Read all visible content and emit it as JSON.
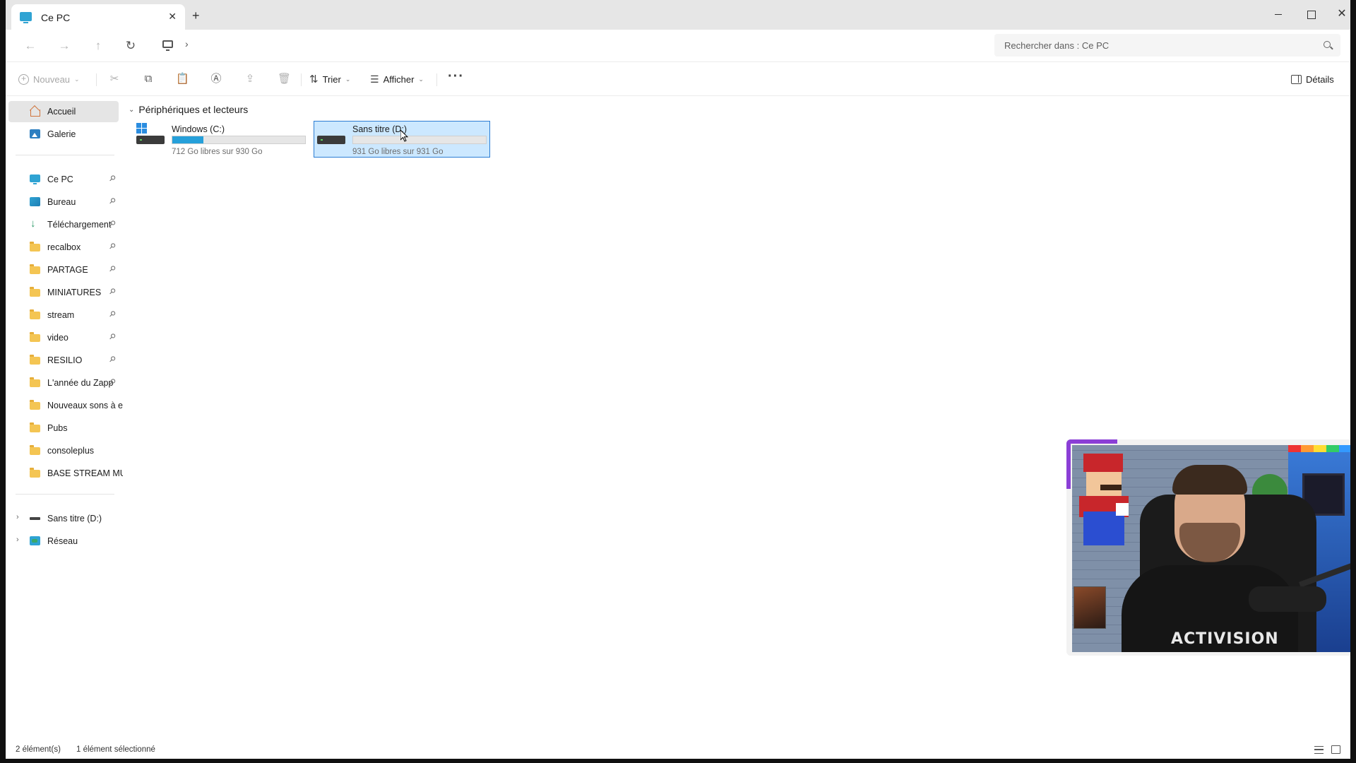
{
  "tab": {
    "title": "Ce PC",
    "close": "✕",
    "new": "+"
  },
  "window_controls": {
    "close": "✕"
  },
  "address": {
    "back": "←",
    "forward": "→",
    "up": "↑",
    "refresh": "↻",
    "chevron": "›",
    "search_placeholder": "Rechercher dans : Ce PC"
  },
  "commandbar": {
    "new_label": "Nouveau",
    "sort_label": "Trier",
    "view_label": "Afficher",
    "more": "···",
    "details_label": "Détails",
    "dropdown": "⌄",
    "icons": {
      "cut": "✂",
      "copy": "⧉",
      "paste": "📋",
      "rename": "Ⓐ",
      "share": "⇪",
      "delete": "🗑",
      "sort": "⇅",
      "view": "☰"
    }
  },
  "sidebar": {
    "top_items": [
      {
        "label": "Accueil",
        "icon": "home-icon",
        "selected": true
      },
      {
        "label": "Galerie",
        "icon": "gallery-icon"
      }
    ],
    "pinned_items": [
      {
        "label": "Ce PC",
        "icon": "pc-icon",
        "pinned": true
      },
      {
        "label": "Bureau",
        "icon": "desktop-icon",
        "pinned": true
      },
      {
        "label": "Téléchargement",
        "icon": "download-icon",
        "pinned": true
      },
      {
        "label": "recalbox",
        "icon": "folder-icon",
        "pinned": true
      },
      {
        "label": "PARTAGE",
        "icon": "folder-icon",
        "pinned": true
      },
      {
        "label": "MINIATURES",
        "icon": "folder-icon",
        "pinned": true
      },
      {
        "label": "stream",
        "icon": "folder-icon",
        "pinned": true
      },
      {
        "label": "video",
        "icon": "folder-icon",
        "pinned": true
      },
      {
        "label": "RESILIO",
        "icon": "folder-icon",
        "pinned": true
      },
      {
        "label": "L'année du Zapp",
        "icon": "folder-icon",
        "pinned": true
      },
      {
        "label": "Nouveaux sons à er",
        "icon": "folder-icon",
        "pinned": false
      },
      {
        "label": "Pubs",
        "icon": "folder-icon",
        "pinned": false
      },
      {
        "label": "consoleplus",
        "icon": "folder-icon",
        "pinned": false
      },
      {
        "label": "BASE STREAM MUS",
        "icon": "folder-icon",
        "pinned": false
      }
    ],
    "bottom_items": [
      {
        "label": "Sans titre (D:)",
        "icon": "drive-icon"
      },
      {
        "label": "Réseau",
        "icon": "network-icon"
      }
    ],
    "pin_glyph": "📌",
    "expand_glyph": "›"
  },
  "content": {
    "group_title": "Périphériques et lecteurs",
    "group_chevron": "⌄",
    "drives": [
      {
        "name": "Windows (C:)",
        "free_text": "712 Go libres sur 930 Go",
        "used_fraction": 0.234,
        "selected": false
      },
      {
        "name": "Sans titre (D:)",
        "free_text": "931 Go libres sur 931 Go",
        "used_fraction": 0.0,
        "selected": true
      }
    ]
  },
  "status": {
    "count": "2 élément(s)",
    "selection": "1 élément sélectionné"
  },
  "webcam": {
    "shirt_text": "ACTIVISION"
  },
  "colors": {
    "accent": "#26a0da",
    "selection_bg": "#cce8ff",
    "selection_border": "#2b7cd3",
    "webcam_frame": "#8b3fd6"
  }
}
